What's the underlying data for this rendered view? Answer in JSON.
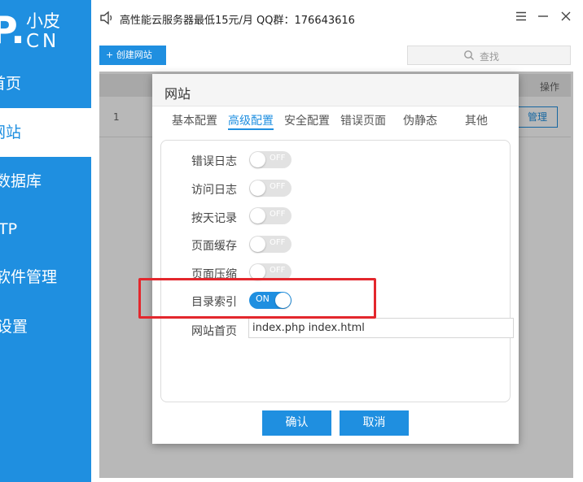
{
  "brand": {
    "mark": "P.",
    "top": "小皮",
    "bottom": "CN"
  },
  "sidebar": {
    "items": [
      {
        "label": "首页"
      },
      {
        "label": "网站"
      },
      {
        "label": "数据库"
      },
      {
        "label": "TP"
      },
      {
        "label": "软件管理"
      },
      {
        "label": "设置"
      }
    ],
    "active": "网站"
  },
  "topbar": {
    "notice": "高性能云服务器最低15元/月  QQ群：176643616",
    "icons": [
      "speaker-icon",
      "menu-icon",
      "minimize-icon",
      "close-icon"
    ]
  },
  "toolbar": {
    "create_label": "+ 创建网站",
    "search_placeholder": "查找"
  },
  "table": {
    "header_op": "操作",
    "rows": [
      {
        "num": "1",
        "action": "管理"
      }
    ]
  },
  "modal": {
    "title": "网站",
    "tabs": [
      {
        "label": "基本配置"
      },
      {
        "label": "高级配置"
      },
      {
        "label": "安全配置"
      },
      {
        "label": "错误页面"
      },
      {
        "label": "伪静态"
      },
      {
        "label": "其他"
      }
    ],
    "active_tab": "高级配置",
    "settings": [
      {
        "label": "错误日志",
        "state": "OFF"
      },
      {
        "label": "访问日志",
        "state": "OFF"
      },
      {
        "label": "按天记录",
        "state": "OFF"
      },
      {
        "label": "页面缓存",
        "state": "OFF"
      },
      {
        "label": "页面压缩",
        "state": "OFF"
      },
      {
        "label": "目录索引",
        "state": "ON"
      }
    ],
    "index_label": "网站首页",
    "index_value": "index.php index.html",
    "confirm_label": "确认",
    "cancel_label": "取消"
  },
  "colors": {
    "accent": "#1f8fe0",
    "highlight": "#e3272d"
  }
}
